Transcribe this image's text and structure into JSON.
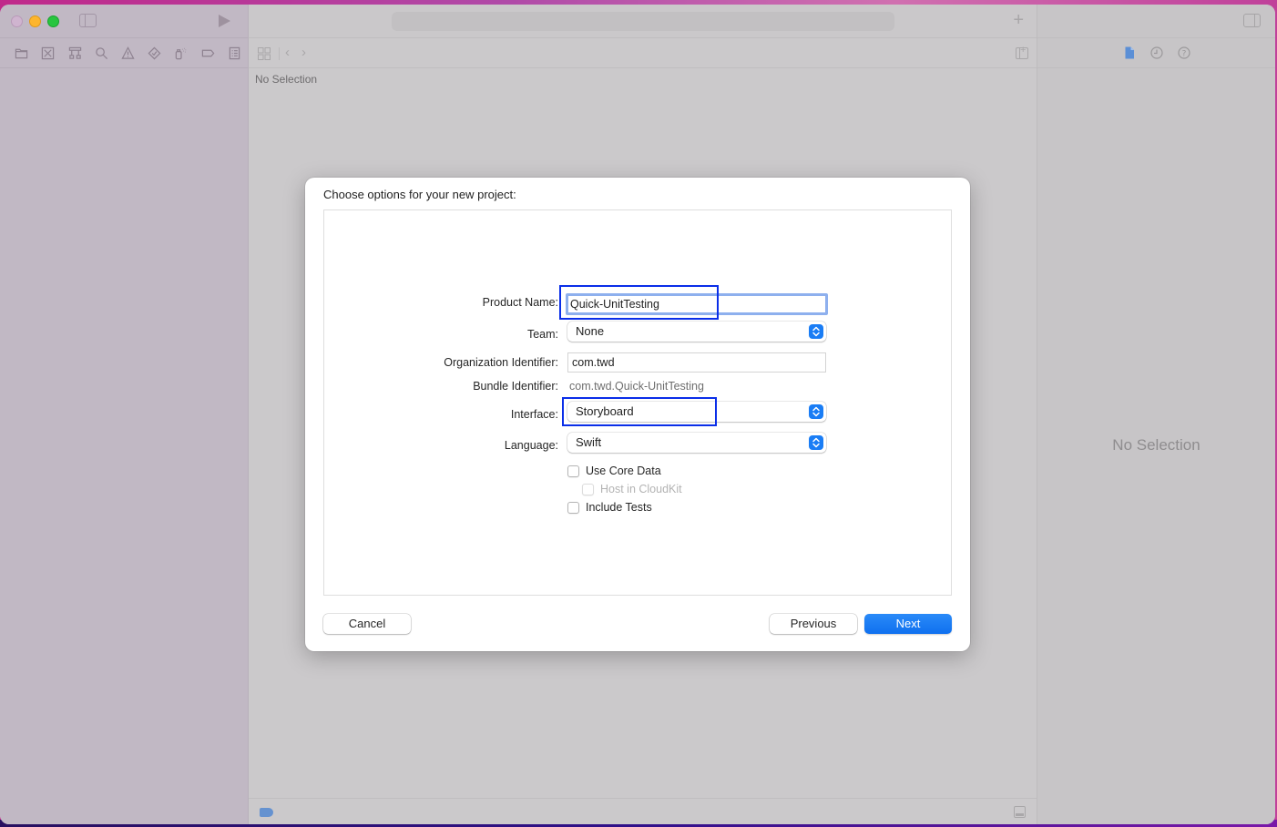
{
  "window": {
    "navigator_toolbar": {
      "icons": [
        "folder-icon",
        "source-control-icon",
        "hierarchy-icon",
        "search-icon",
        "warning-icon",
        "test-diamond-icon",
        "debug-spray-icon",
        "breakpoint-icon",
        "report-list-icon"
      ]
    },
    "editor": {
      "jump_bar_text": "No Selection"
    },
    "inspector": {
      "tabs": [
        "file-inspector-icon",
        "history-icon",
        "help-icon"
      ],
      "empty_text": "No Selection"
    }
  },
  "dialog": {
    "title": "Choose options for your new project:",
    "fields": {
      "product_name": {
        "label": "Product Name:",
        "value": "Quick-UnitTesting"
      },
      "team": {
        "label": "Team:",
        "value": "None"
      },
      "organization_identifier": {
        "label": "Organization Identifier:",
        "value": "com.twd"
      },
      "bundle_identifier": {
        "label": "Bundle Identifier:",
        "value": "com.twd.Quick-UnitTesting"
      },
      "interface": {
        "label": "Interface:",
        "value": "Storyboard"
      },
      "language": {
        "label": "Language:",
        "value": "Swift"
      }
    },
    "checkboxes": {
      "use_core_data": {
        "label": "Use Core Data",
        "checked": false,
        "enabled": true
      },
      "host_in_cloudkit": {
        "label": "Host in CloudKit",
        "checked": false,
        "enabled": false
      },
      "include_tests": {
        "label": "Include Tests",
        "checked": false,
        "enabled": true
      }
    },
    "buttons": {
      "cancel": "Cancel",
      "previous": "Previous",
      "next": "Next"
    }
  },
  "colors": {
    "accent": "#1a7df5",
    "annotation_box": "#0a2ee8",
    "focus_ring": "#8eb0ee"
  }
}
